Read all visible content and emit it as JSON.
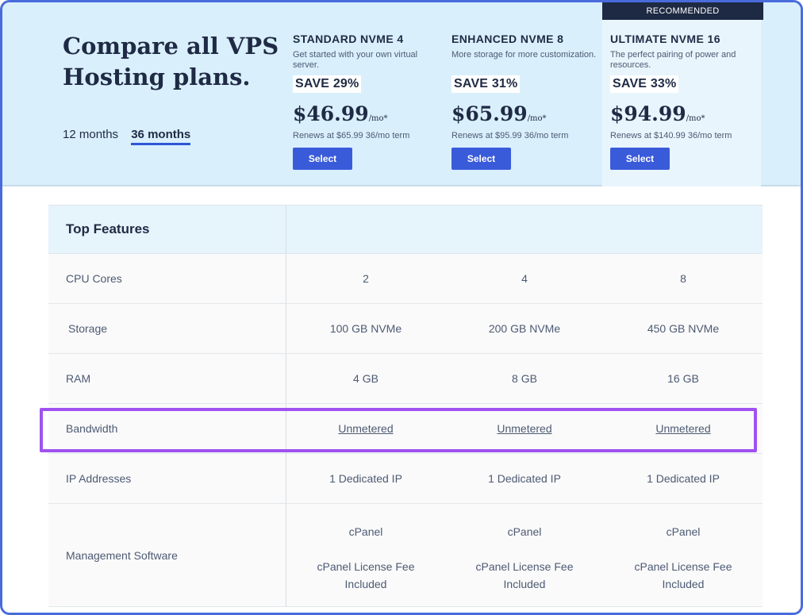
{
  "header": {
    "title": "Compare all VPS Hosting plans.",
    "terms": [
      {
        "label": "12 months",
        "active": false
      },
      {
        "label": "36 months",
        "active": true
      }
    ]
  },
  "plans": [
    {
      "name": "STANDARD NVME 4",
      "description": "Get started with your own virtual server.",
      "save": "SAVE 29%",
      "price": "$46.99",
      "unit": "/mo*",
      "renew": "Renews at $65.99 36/mo term",
      "button": "Select"
    },
    {
      "name": "ENHANCED NVME 8",
      "description": "More storage for more customization.",
      "save": "SAVE 31%",
      "price": "$65.99",
      "unit": "/mo*",
      "renew": "Renews at $95.99 36/mo term",
      "button": "Select"
    },
    {
      "name": "ULTIMATE NVME 16",
      "badge": "RECOMMENDED",
      "description": "The perfect pairing of power and resources.",
      "save": "SAVE 33%",
      "price": "$94.99",
      "unit": "/mo*",
      "renew": "Renews at $140.99 36/mo term",
      "button": "Select"
    }
  ],
  "table": {
    "header": "Top Features",
    "rows": [
      {
        "label": "CPU Cores",
        "values": [
          "2",
          "4",
          "8"
        ]
      },
      {
        "label": "Storage",
        "values": [
          "100 GB NVMe",
          "200 GB NVMe",
          "450 GB NVMe"
        ]
      },
      {
        "label": "RAM",
        "values": [
          "4 GB",
          "8 GB",
          "16 GB"
        ]
      },
      {
        "label": "Bandwidth",
        "values": [
          "Unmetered",
          "Unmetered",
          "Unmetered"
        ]
      },
      {
        "label": "IP Addresses",
        "values": [
          "1 Dedicated IP",
          "1 Dedicated IP",
          "1 Dedicated IP"
        ]
      },
      {
        "label": "Management Software",
        "values": [
          {
            "line1": "cPanel",
            "line2": "cPanel License Fee",
            "line3": "Included"
          },
          {
            "line1": "cPanel",
            "line2": "cPanel License Fee",
            "line3": "Included"
          },
          {
            "line1": "cPanel",
            "line2": "cPanel License Fee",
            "line3": "Included"
          }
        ]
      }
    ]
  },
  "colors": {
    "hero_bg": "#d9effc",
    "accent": "#3a5bd9",
    "badge_bg": "#1e2a43",
    "highlight": "#a052f0"
  }
}
